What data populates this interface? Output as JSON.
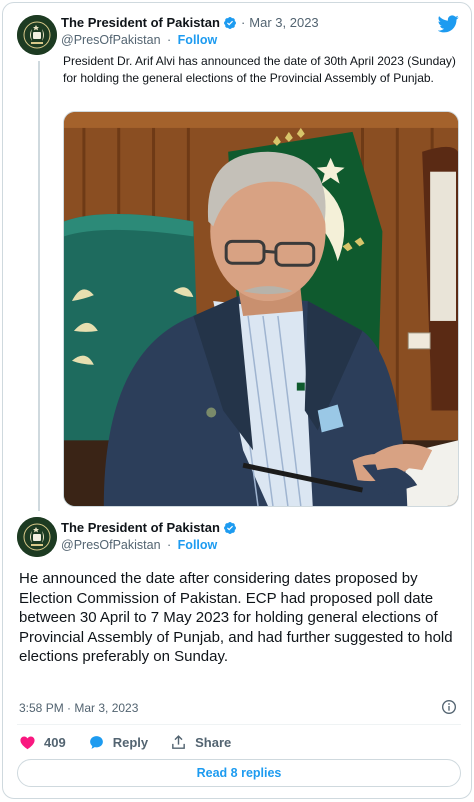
{
  "colors": {
    "accent": "#1d9bf0",
    "text_primary": "#0f1419",
    "text_secondary": "#536471",
    "like_red": "#f91880",
    "border": "#cfd9de"
  },
  "tweet1": {
    "author_name": "The President of Pakistan",
    "handle": "@PresOfPakistan",
    "separator": "·",
    "follow_label": "Follow",
    "date": "Mar 3, 2023",
    "text": "President Dr. Arif Alvi has announced the date of 30th April 2023 (Sunday) for holding the general elections of the Provincial Assembly of Punjab.",
    "icons": [
      "verified-badge-icon",
      "twitter-bird-icon"
    ]
  },
  "tweet2": {
    "author_name": "The President of Pakistan",
    "handle": "@PresOfPakistan",
    "separator": "·",
    "follow_label": "Follow",
    "text": "He announced the date after considering dates proposed by Election Commission of Pakistan. ECP had proposed poll date between 30 April to 7 May 2023 for holding general elections of Provincial Assembly of Punjab, and had further suggested to hold elections preferably on Sunday.",
    "timestamp": "3:58 PM · Mar 3, 2023",
    "likes": "409",
    "reply_label": "Reply",
    "share_label": "Share",
    "read_replies_label": "Read 8 replies",
    "icons": [
      "heart-icon",
      "reply-bubble-icon",
      "share-icon",
      "info-icon"
    ]
  }
}
